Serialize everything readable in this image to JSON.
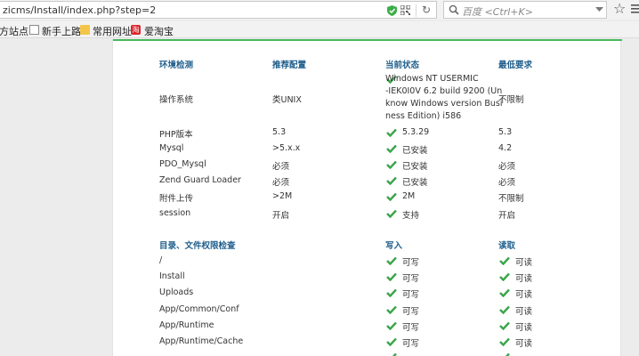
{
  "browser": {
    "url": "zicms/Install/index.php?step=2",
    "search_placeholder": "百度 <Ctrl+K>",
    "bookmarks": [
      {
        "label": "方站点"
      },
      {
        "label": "新手上路"
      },
      {
        "label": "常用网址"
      },
      {
        "label": "爱淘宝"
      }
    ]
  },
  "env": {
    "headers": {
      "item": "环境检测",
      "recommended": "推荐配置",
      "current": "当前状态",
      "minimum": "最低要求"
    },
    "rows": [
      {
        "item": "操作系统",
        "recommended": "类UNIX",
        "current": "Windows NT USERMIC\n-IEK0I0V 6.2 build 9200 (Un\nknow Windows version Busi\nness Edition) i586",
        "minimum": "不限制"
      },
      {
        "item": "PHP版本",
        "recommended": "5.3",
        "current": "5.3.29",
        "minimum": "5.3"
      },
      {
        "item": "Mysql",
        "recommended": ">5.x.x",
        "current": "已安装",
        "minimum": "4.2"
      },
      {
        "item": "PDO_Mysql",
        "recommended": "必须",
        "current": "已安装",
        "minimum": "必须"
      },
      {
        "item": "Zend Guard Loader",
        "recommended": "必须",
        "current": "已安装",
        "minimum": "必须"
      },
      {
        "item": "附件上传",
        "recommended": ">2M",
        "current": "2M",
        "minimum": "不限制"
      },
      {
        "item": "session",
        "recommended": "开启",
        "current": "支持",
        "minimum": "开启"
      }
    ]
  },
  "perm": {
    "headers": {
      "dir": "目录、文件权限检查",
      "write": "写入",
      "read": "读取"
    },
    "rows": [
      {
        "dir": "/",
        "write": "可写",
        "read": "可读"
      },
      {
        "dir": "Install",
        "write": "可写",
        "read": "可读"
      },
      {
        "dir": "Uploads",
        "write": "可写",
        "read": "可读"
      },
      {
        "dir": "App/Common/Conf",
        "write": "可写",
        "read": "可读"
      },
      {
        "dir": "App/Runtime",
        "write": "可写",
        "read": "可读"
      },
      {
        "dir": "App/Runtime/Cache",
        "write": "可写",
        "read": "可读"
      }
    ]
  },
  "colors": {
    "accent": "#45b95b",
    "header": "#1f5e8c",
    "check": "#3aa54a"
  }
}
